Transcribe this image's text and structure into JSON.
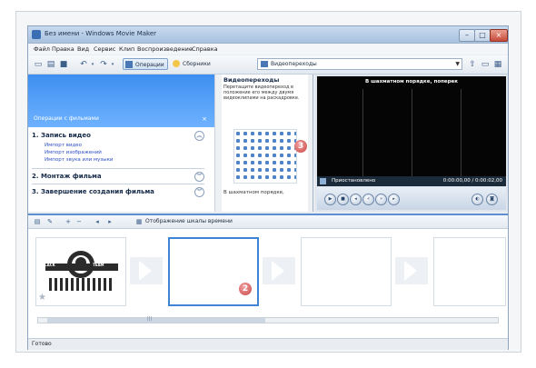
{
  "window": {
    "title": "Без имени - Windows Movie Maker"
  },
  "menu": [
    "Файл",
    "Правка",
    "Вид",
    "Сервис",
    "Клип",
    "Воспроизведение",
    "Справка"
  ],
  "toolbar": {
    "tasks_label": "Операции",
    "collections_label": "Сборники",
    "collection_value": "Видеопереходы"
  },
  "task_pane": {
    "header": "Операции с фильмами",
    "sections": [
      {
        "number": "1.",
        "title": "Запись видео",
        "links": [
          "Импорт видео",
          "Импорт изображений",
          "Импорт звука или музыки"
        ]
      },
      {
        "number": "2.",
        "title": "Монтаж фильма",
        "links": []
      },
      {
        "number": "3.",
        "title": "Завершение создания фильма",
        "links": []
      }
    ]
  },
  "transitions": {
    "title": "Видеопереходы",
    "description": "Перетащите видеопереход в положение его между двумя видеоклипами на раскадровке.",
    "caption": "В шахматном порядке,",
    "badge": "3"
  },
  "preview": {
    "caption": "В шахматном порядке, поперек",
    "status": "Приостановлено",
    "time": "0:00:00,00 / 0:00:02,00"
  },
  "timeline": {
    "toggle_label": "Отображение шкалы времени",
    "clip_badge": "2",
    "thumbnail_words": [
      "BLACK",
      "TEAM"
    ]
  },
  "status": {
    "text": "Готово"
  },
  "colors": {
    "accent": "#3d8ff0",
    "badge": "#c94545",
    "link": "#2c4fc4"
  }
}
